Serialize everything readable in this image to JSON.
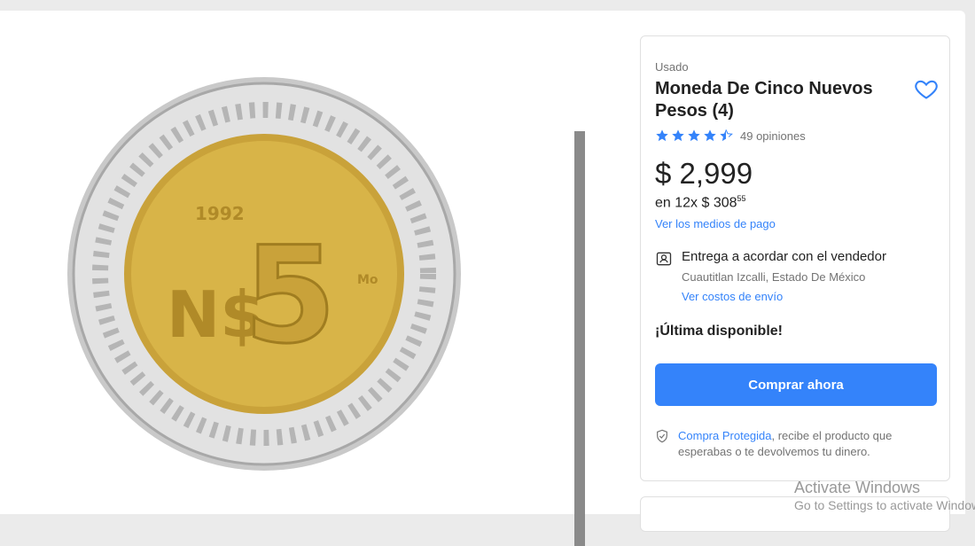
{
  "product": {
    "condition": "Usado",
    "title": "Moneda De Cinco Nuevos Pesos (4)",
    "rating": 4.5,
    "reviews_label": "49 opiniones",
    "price": "$ 2,999",
    "installments_prefix": "en 12x $ 308",
    "installments_cents": "55",
    "payment_link": "Ver los medios de pago"
  },
  "coin": {
    "year": "1992",
    "denomination_prefix": "N$",
    "denomination": "5",
    "mint_mark": "Mo"
  },
  "shipping": {
    "title": "Entrega a acordar con el vendedor",
    "location": "Cuautitlan Izcalli, Estado De México",
    "costs_link": "Ver costos de envío"
  },
  "stock": "¡Última disponible!",
  "buy_button": "Comprar ahora",
  "protection": {
    "link": "Compra Protegida",
    "text": ", recibe el producto que esperabas o te devolvemos tu dinero."
  },
  "watermark": {
    "title": "Activate Windows",
    "subtitle": "Go to Settings to activate Windows."
  },
  "colors": {
    "accent": "#3483fa",
    "coin_gold": "#d8b448",
    "coin_silver": "#d9d9d9"
  },
  "icons": [
    "heart-icon",
    "star-icon",
    "star-half-icon",
    "store-pickup-icon",
    "shield-check-icon"
  ]
}
